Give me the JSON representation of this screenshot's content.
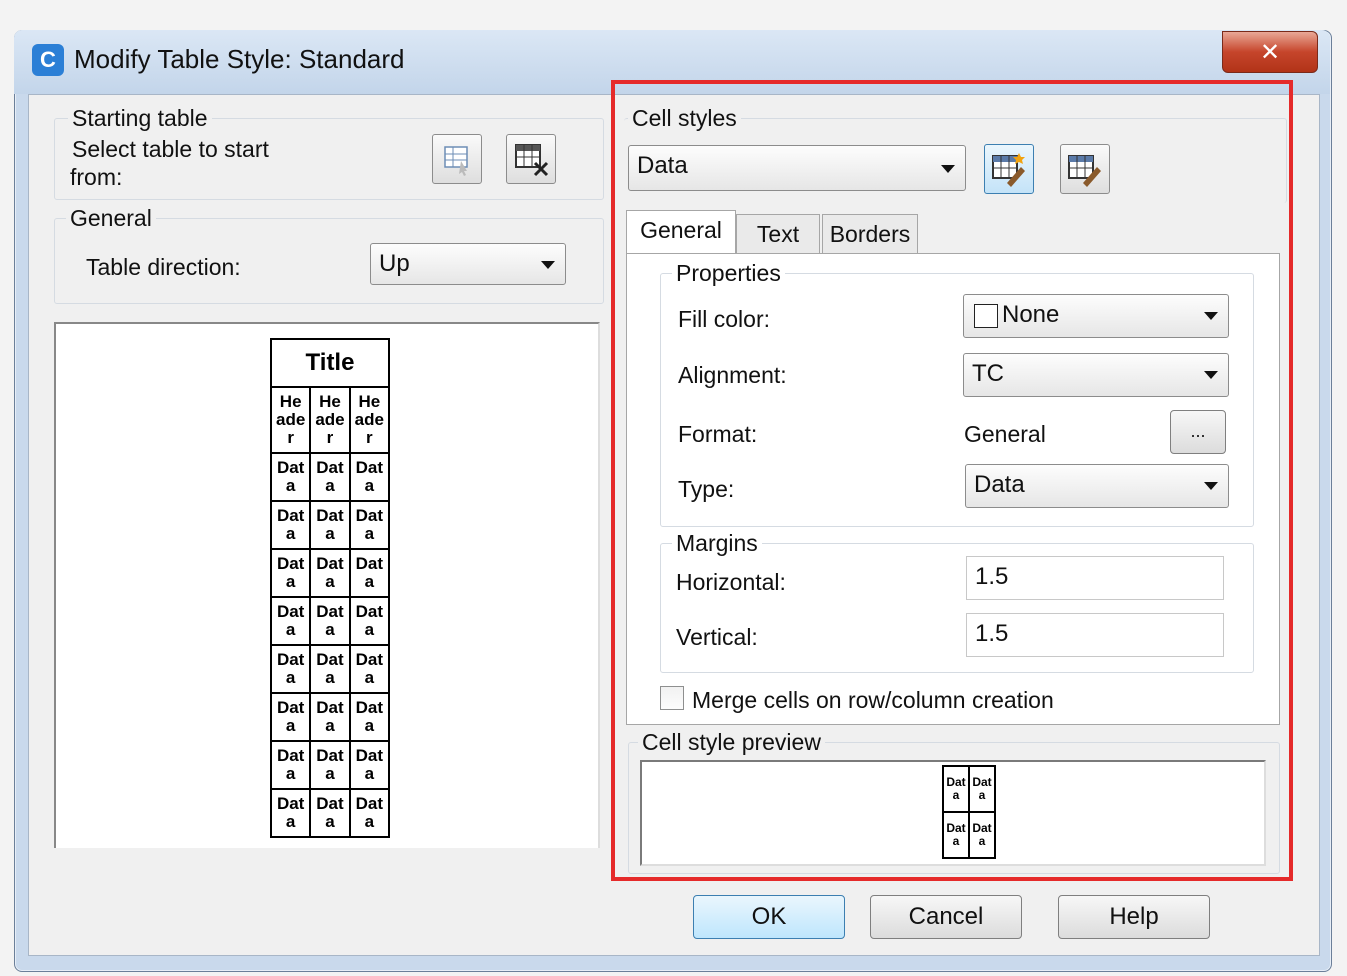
{
  "window": {
    "title": "Modify Table Style: Standard",
    "close_glyph": "✕",
    "app_icon_glyph": "C"
  },
  "starting_table": {
    "legend": "Starting table",
    "label_line1": "Select table to start",
    "label_line2": "from:",
    "select_icon": "table-select-icon",
    "remove_icon": "table-remove-icon"
  },
  "general": {
    "legend": "General",
    "direction_label": "Table direction:",
    "direction_value": "Up"
  },
  "preview": {
    "title": "Title",
    "header_line1": "He",
    "header_line2": "ade",
    "header_line3": "r",
    "data_line1": "Dat",
    "data_line2": "a",
    "row_count": 8
  },
  "cell_styles": {
    "legend": "Cell styles",
    "selected": "Data",
    "new_icon": "new-cell-style-icon",
    "manage_icon": "manage-cell-styles-icon"
  },
  "tabs": [
    {
      "label": "General"
    },
    {
      "label": "Text"
    },
    {
      "label": "Borders"
    }
  ],
  "properties": {
    "legend": "Properties",
    "fill_color": {
      "label": "Fill color:",
      "value": "None"
    },
    "alignment": {
      "label": "Alignment:",
      "value": "TC"
    },
    "format": {
      "label": "Format:",
      "value": "General",
      "button": "..."
    },
    "type": {
      "label": "Type:",
      "value": "Data"
    }
  },
  "margins": {
    "legend": "Margins",
    "horizontal": {
      "label": "Horizontal:",
      "value": "1.5"
    },
    "vertical": {
      "label": "Vertical:",
      "value": "1.5"
    }
  },
  "merge_checkbox": {
    "label": "Merge cells on row/column creation",
    "checked": false
  },
  "cell_preview": {
    "legend": "Cell style preview",
    "cell_text_top": "Dat",
    "cell_text_bottom": "a"
  },
  "buttons": {
    "ok": "OK",
    "cancel": "Cancel",
    "help": "Help"
  },
  "colors": {
    "highlight_border": "#e52a2a",
    "titlebar": "#c9d9ec"
  }
}
